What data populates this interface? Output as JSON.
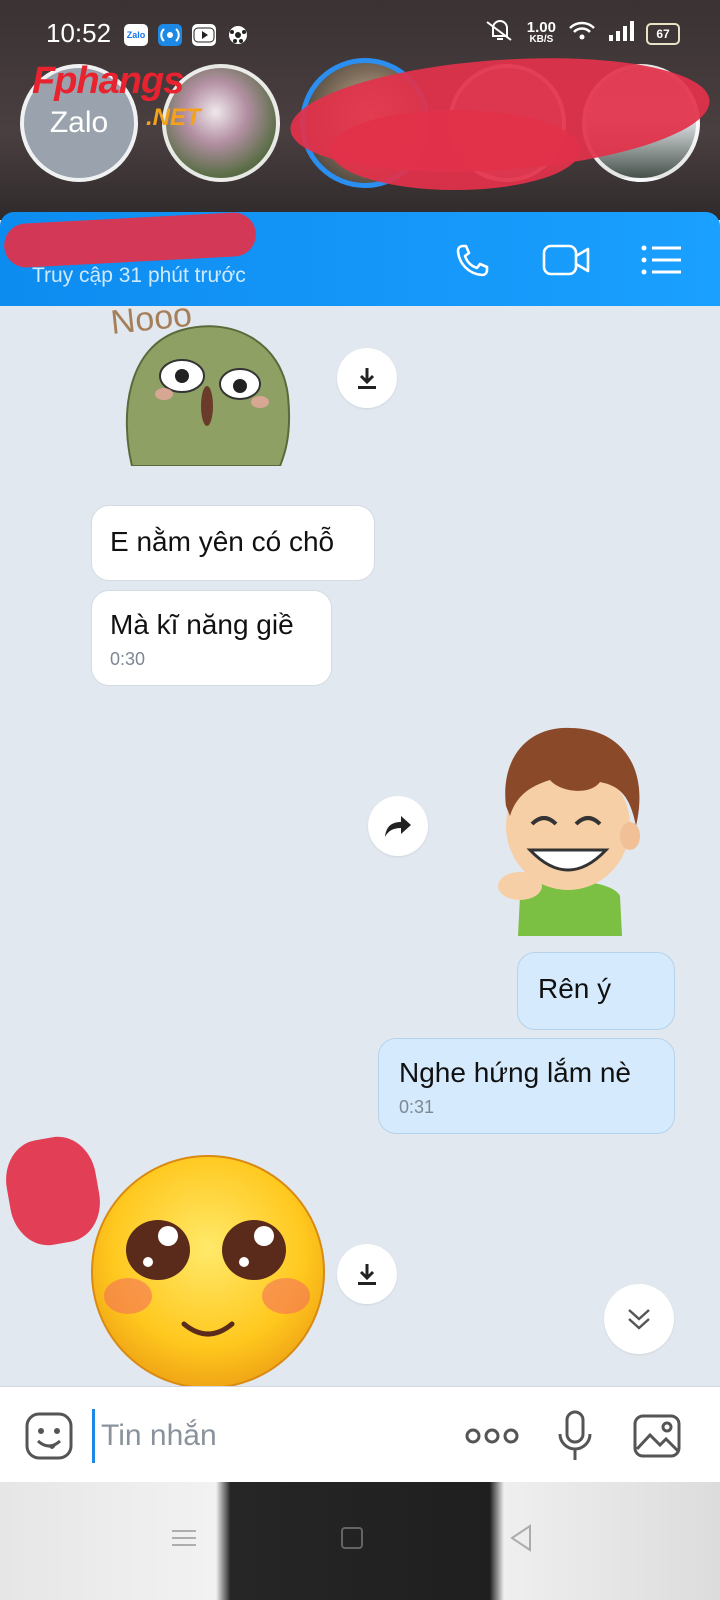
{
  "status_bar": {
    "time": "10:52",
    "app_zalo": "Zalo",
    "net_speed_value": "1.00",
    "net_speed_unit": "KB/S",
    "battery": "67"
  },
  "bubble_heads": {
    "zalo_label": "Zalo",
    "watermark": "Fphangs",
    "watermark_net": ".NET"
  },
  "header": {
    "subtitle": "Truy cập 31 phút trước",
    "icons": [
      "phone-icon",
      "video-call-icon",
      "menu-list-icon"
    ]
  },
  "messages": [
    {
      "type": "sticker",
      "direction": "in",
      "sticker": "nooo-cactus-sticker",
      "text": "Nooo"
    },
    {
      "type": "text",
      "direction": "in",
      "text": "E nằm yên có chỗ"
    },
    {
      "type": "text",
      "direction": "in",
      "text": "Mà kĩ năng giề",
      "time": "0:30"
    },
    {
      "type": "sticker",
      "direction": "out",
      "sticker": "laughing-boy-sticker"
    },
    {
      "type": "text",
      "direction": "out",
      "text": "Rên ý"
    },
    {
      "type": "text",
      "direction": "out",
      "text": "Nghe hứng lắm nè",
      "time": "0:31"
    },
    {
      "type": "sticker",
      "direction": "in",
      "sticker": "blushing-emoji-sticker"
    }
  ],
  "composer": {
    "placeholder": "Tin nhắn"
  },
  "colors": {
    "header": "#0d8cf0",
    "chat_background": "#e2e8ef",
    "outgoing_bubble": "#d5ebfd",
    "incoming_bubble": "#ffffff"
  }
}
